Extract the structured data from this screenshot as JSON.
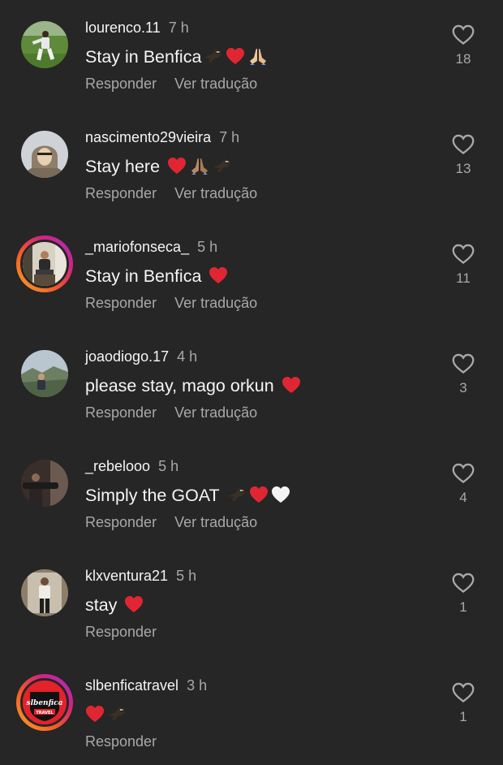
{
  "colors": {
    "background": "#262626",
    "primary_text": "#f5f5f5",
    "secondary_text": "#a8a8a8",
    "heart_red": "#e02633",
    "story_ring": [
      "#f9a524",
      "#f3562b",
      "#d3237e",
      "#a52fcf"
    ]
  },
  "comments": [
    {
      "username": "lourenco.11",
      "time": "7 h",
      "text": "Stay in Benfica",
      "emojis": [
        "eagle-emoji",
        "red-heart-emoji",
        "folded-hands-emoji"
      ],
      "reply_label": "Responder",
      "translate_label": "Ver tradução",
      "likes": "18",
      "avatar": "soccer-player-photo",
      "story_ring": false
    },
    {
      "username": "nascimento29vieira",
      "time": "7 h",
      "text": "Stay here",
      "emojis": [
        "red-heart-emoji",
        "folded-hands-emoji",
        "eagle-emoji"
      ],
      "reply_label": "Responder",
      "translate_label": "Ver tradução",
      "likes": "13",
      "avatar": "hooded-person-photo",
      "story_ring": false
    },
    {
      "username": "_mariofonseca_",
      "time": "5 h",
      "text": "Stay in Benfica",
      "emojis": [
        "red-heart-emoji"
      ],
      "reply_label": "Responder",
      "translate_label": "Ver tradução",
      "likes": "11",
      "avatar": "seated-person-photo",
      "story_ring": true
    },
    {
      "username": "joaodiogo.17",
      "time": "4 h",
      "text": "please stay, mago orkun",
      "emojis": [
        "red-heart-emoji"
      ],
      "reply_label": "Responder",
      "translate_label": "Ver tradução",
      "likes": "3",
      "avatar": "landscape-photo",
      "story_ring": false
    },
    {
      "username": "_rebelooo",
      "time": "5 h",
      "text": "Simply the GOAT",
      "emojis": [
        "eagle-emoji",
        "red-heart-emoji",
        "white-heart-emoji"
      ],
      "reply_label": "Responder",
      "translate_label": "Ver tradução",
      "likes": "4",
      "avatar": "dark-room-photo",
      "story_ring": false
    },
    {
      "username": "klxventura21",
      "time": "5 h",
      "text": "stay",
      "emojis": [
        "red-heart-emoji"
      ],
      "reply_label": "Responder",
      "translate_label": "",
      "likes": "1",
      "avatar": "mirror-selfie-photo",
      "story_ring": false
    },
    {
      "username": "slbenficatravel",
      "time": "3 h",
      "text": "",
      "emojis": [
        "red-heart-emoji",
        "eagle-emoji"
      ],
      "reply_label": "Responder",
      "translate_label": "",
      "likes": "1",
      "avatar": "slbenfica-travel-logo",
      "avatar_logo_text": "slbenfica",
      "avatar_logo_subtext": "TRAVEL",
      "story_ring": true
    }
  ]
}
